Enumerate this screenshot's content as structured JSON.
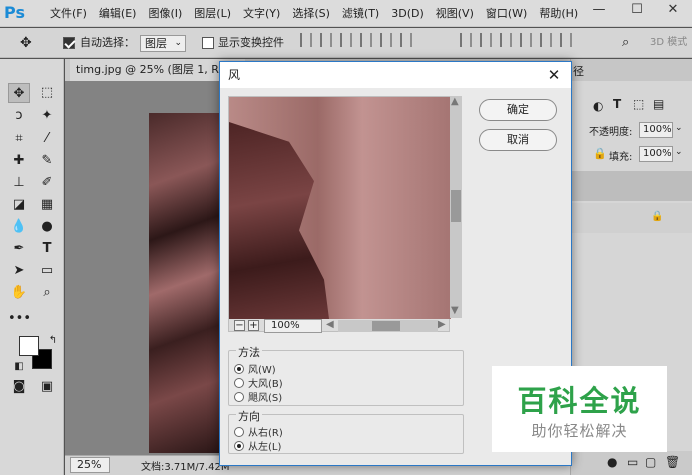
{
  "app": {
    "logo": "Ps"
  },
  "menu": [
    "文件(F)",
    "编辑(E)",
    "图像(I)",
    "图层(L)",
    "文字(Y)",
    "选择(S)",
    "滤镜(T)",
    "3D(D)",
    "视图(V)",
    "窗口(W)",
    "帮助(H)"
  ],
  "window_controls": {
    "minimize": "—",
    "maximize": "☐",
    "close": "✕"
  },
  "options": {
    "auto_select_label": "自动选择：",
    "auto_select_value": "图层",
    "show_transform_label": "显示变换控件",
    "mode_3d": "3D 模式"
  },
  "document": {
    "tab_title": "timg.jpg @ 25% (图层 1, RGB/"
  },
  "status": {
    "zoom": "25%",
    "doc_size": "文档:3.71M/7.42M"
  },
  "right_panel": {
    "opacity_label": "不透明度:",
    "opacity_value": "100%",
    "fill_label": "填充:",
    "fill_value": "100%",
    "tab_partial": "径"
  },
  "dialog": {
    "title": "风",
    "ok": "确定",
    "cancel": "取消",
    "preview_zoom": "100%",
    "method": {
      "label": "方法",
      "options": [
        "风(W)",
        "大风(B)",
        "飓风(S)"
      ],
      "selected": 0
    },
    "direction": {
      "label": "方向",
      "options": [
        "从右(R)",
        "从左(L)"
      ],
      "selected": 1
    }
  },
  "watermark": {
    "line1": "百科全说",
    "line2": "助你轻松解决"
  },
  "colors": {
    "ps_blue": "#1b8bd6",
    "dialog_border": "#2b78c6",
    "watermark_green": "#2ea24a"
  }
}
